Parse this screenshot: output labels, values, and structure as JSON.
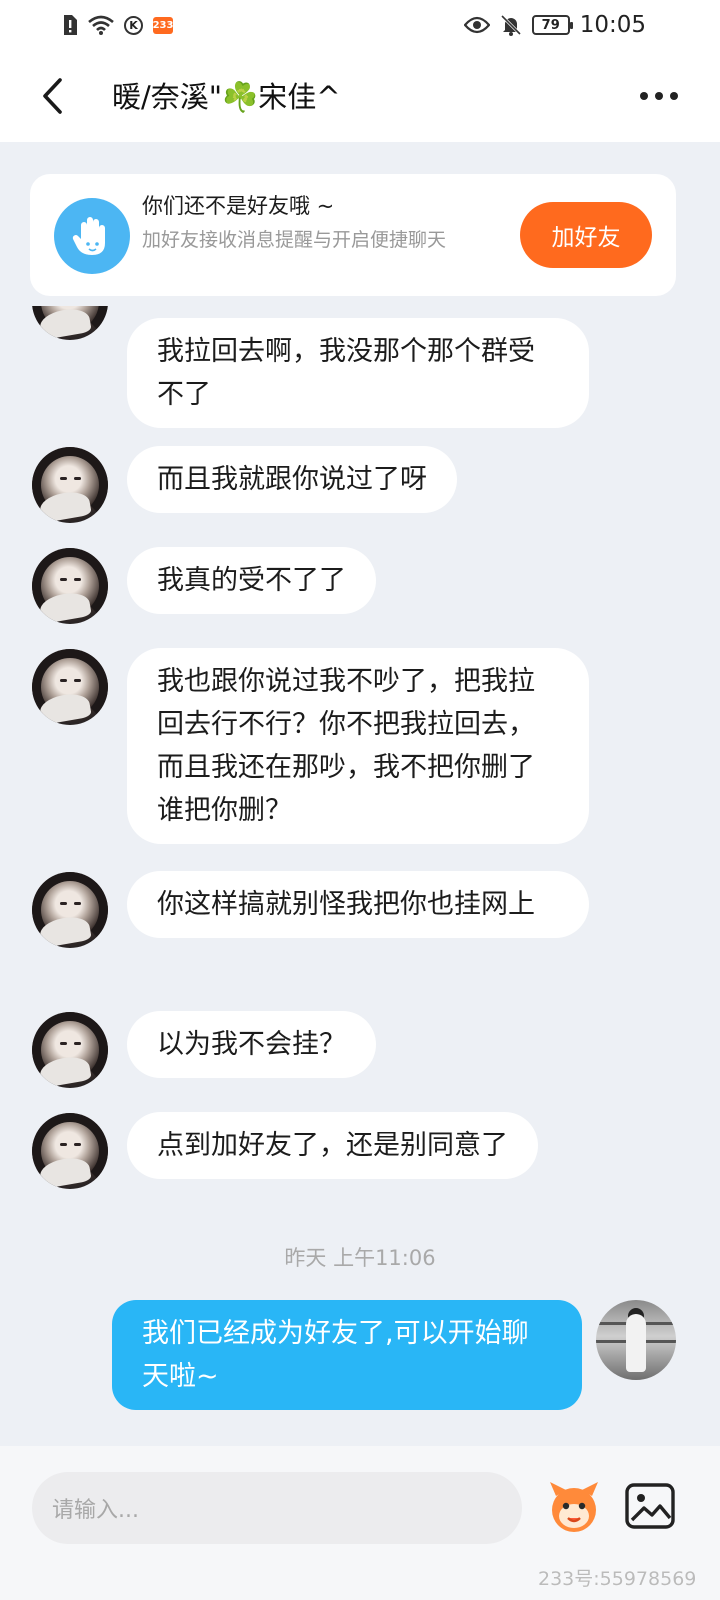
{
  "status_bar": {
    "badge": "233",
    "k_label": "K",
    "battery": "79",
    "time": "10:05"
  },
  "header": {
    "title": "暖/奈溪\"☘️宋佳^"
  },
  "friend_card": {
    "title": "你们还不是好友哦 ~",
    "subtitle": "加好友接收消息提醒与开启便捷聊天",
    "add_button": "加好友"
  },
  "messages": [
    {
      "text": "我拉回去啊，我没那个那个群受不了",
      "from": "other"
    },
    {
      "text": "而且我就跟你说过了呀",
      "from": "other"
    },
    {
      "text": "我真的受不了了",
      "from": "other"
    },
    {
      "text": "我也跟你说过我不吵了，把我拉回去行不行？你不把我拉回去，而且我还在那吵，我不把你删了谁把你删？",
      "from": "other"
    },
    {
      "text": "你这样搞就别怪我把你也挂网上",
      "from": "other"
    },
    {
      "text": "以为我不会挂？",
      "from": "other"
    },
    {
      "text": "点到加好友了，还是别同意了",
      "from": "other"
    }
  ],
  "timestamp": "昨天 上午11:06",
  "my_message": "我们已经成为好友了,可以开始聊天啦~",
  "input": {
    "placeholder": "请输入..."
  },
  "watermark": "233号:55978569",
  "colors": {
    "accent_orange": "#ff6a1e",
    "my_bubble": "#29b6f6",
    "background": "#edf0f5"
  }
}
